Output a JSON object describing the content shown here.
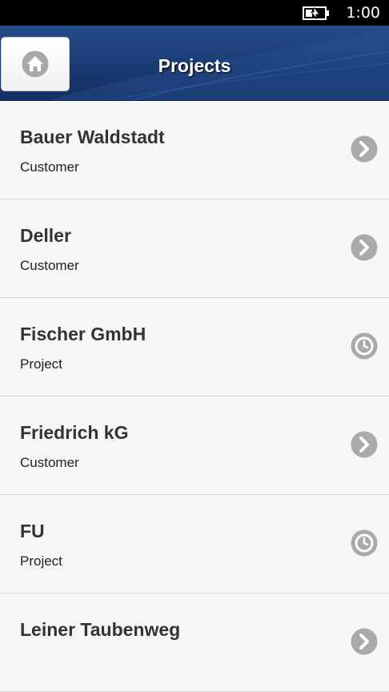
{
  "status_bar": {
    "time": "1:00",
    "battery_icon": "battery-charging-icon"
  },
  "header": {
    "title": "Projects",
    "home_icon": "home-icon"
  },
  "colors": {
    "header": "#1a3a73",
    "list_background": "#f6f6f6",
    "icon_gray": "#aaaaaa",
    "divider": "#d6d6d6"
  },
  "projects": [
    {
      "title": "Bauer Waldstadt",
      "subtitle": "Customer",
      "icon": "chevron-right-icon"
    },
    {
      "title": "Deller",
      "subtitle": "Customer",
      "icon": "chevron-right-icon"
    },
    {
      "title": "Fischer GmbH",
      "subtitle": "Project",
      "icon": "clock-icon"
    },
    {
      "title": "Friedrich kG",
      "subtitle": "Customer",
      "icon": "chevron-right-icon"
    },
    {
      "title": "FU",
      "subtitle": "Project",
      "icon": "clock-icon"
    },
    {
      "title": "Leiner Taubenweg",
      "subtitle": "",
      "icon": "chevron-right-icon"
    }
  ]
}
